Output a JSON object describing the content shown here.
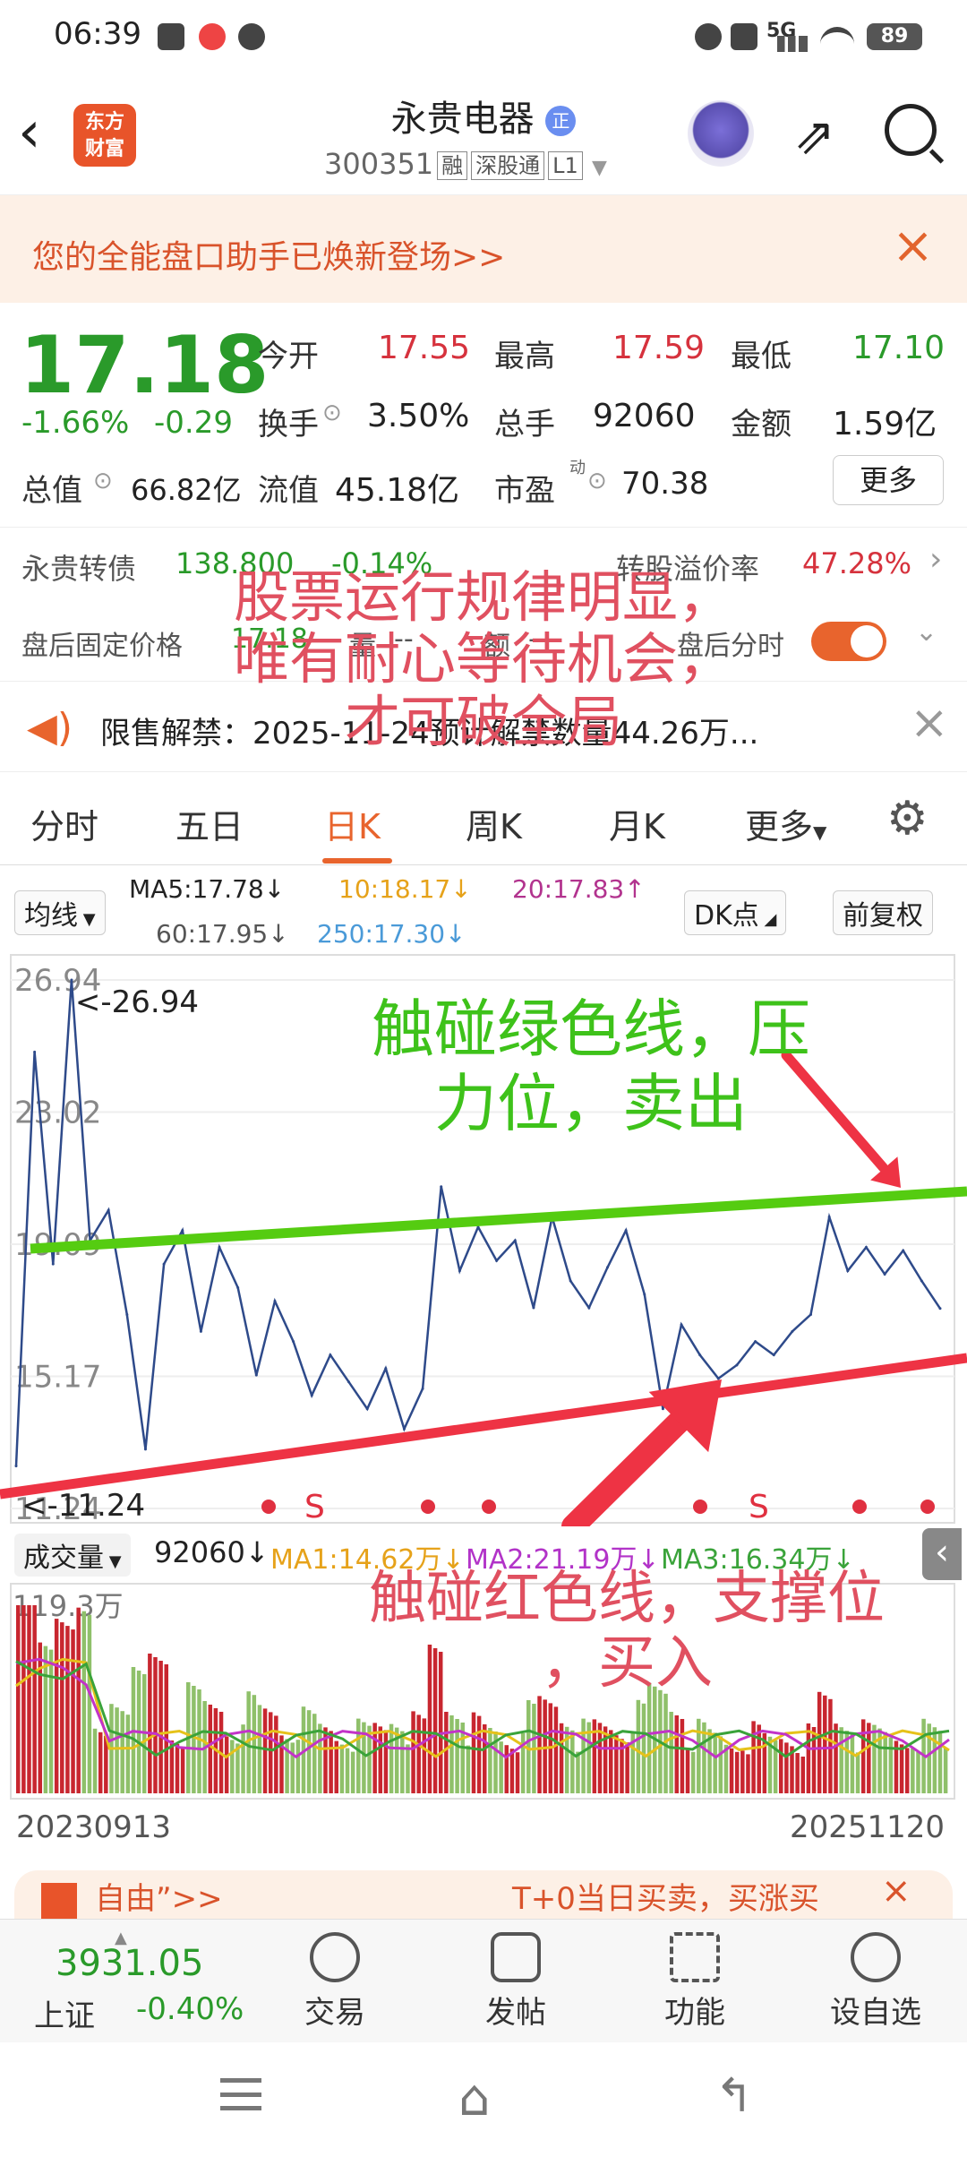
{
  "status_bar": {
    "time": "06:39",
    "battery": "89",
    "network": "5G"
  },
  "header": {
    "app_logo": "东方\n财富",
    "stock_name": "永贵电器",
    "badge": "正",
    "code": "300351",
    "tags": [
      "融",
      "深股通",
      "L1"
    ]
  },
  "banner": {
    "text": "您的全能盘口助手已焕新登场>>"
  },
  "quote": {
    "price": "17.18",
    "change_pct": "-1.66%",
    "change": "-0.29",
    "open_label": "今开",
    "open": "17.55",
    "high_label": "最高",
    "high": "17.59",
    "low_label": "最低",
    "low": "17.10",
    "turnover_label": "换手",
    "turnover": "3.50%",
    "volume_label": "总手",
    "volume": "92060",
    "amount_label": "金额",
    "amount": "1.59亿",
    "mcap_label": "总值",
    "mcap": "66.82亿",
    "float_label": "流值",
    "float": "45.18亿",
    "pe_label": "市盈",
    "pe_sup": "动",
    "pe": "70.38",
    "more": "更多"
  },
  "bond": {
    "name": "永贵转债",
    "price": "138.800",
    "change": "-0.14%",
    "premium_label": "转股溢价率",
    "premium": "47.28%"
  },
  "after_hours": {
    "fixed_price_label": "盘后固定价格",
    "fixed_price": "17.18",
    "volume_label": "量",
    "volume": "--",
    "amount_label": "额",
    "amount": "--",
    "timeshare_label": "盘后分时"
  },
  "notice": {
    "text": "限售解禁：2025-11-24预计解禁数量44.26万..."
  },
  "overlay": {
    "top_red": [
      "股票运行规律明显，",
      "唯有耐心等待机会，",
      "才可破全局"
    ],
    "green": [
      "触碰绿色线，压",
      "力位，卖出"
    ],
    "bottom_red": [
      "触碰红色线，支撑位",
      "，买入"
    ]
  },
  "tabs": [
    "分时",
    "五日",
    "日K",
    "周K",
    "月K",
    "更多",
    "settings"
  ],
  "active_tab": "日K",
  "ma_bar": {
    "selector": "均线",
    "ma5": "MA5:17.78↓",
    "ma10": "10:18.17↓",
    "ma20": "20:17.83↑",
    "ma60": "60:17.95↓",
    "ma250": "250:17.30↓",
    "dk": "DK点",
    "adjust": "前复权"
  },
  "price_chart": {
    "y_ticks": [
      "26.94",
      "23.02",
      "19.09",
      "15.17",
      "11.24"
    ],
    "max_label": "<-26.94",
    "min_label": "<-11.24",
    "s_marks": [
      "S",
      "S"
    ]
  },
  "volume_bar": {
    "selector": "成交量",
    "volume": "92060↓",
    "ma1": "MA1:14.62万↓",
    "ma2": "MA2:21.19万↓",
    "ma3": "MA3:16.34万↓",
    "y_max": "119.3万"
  },
  "date_range": {
    "start": "20230913",
    "end": "20251120"
  },
  "promo": {
    "left": "自由”>>",
    "right": "T+0当日买卖，买涨买"
  },
  "bottom_bar": {
    "index_value": "3931.05",
    "index_name": "上证",
    "index_change": "-0.40%",
    "items": [
      "交易",
      "发帖",
      "功能",
      "设自选"
    ]
  },
  "colors": {
    "accent": "#e8642d",
    "up": "#d6323d",
    "down": "#2a9a2a",
    "support_line": "#ee3344",
    "resistance_line": "#55cc11"
  },
  "chart_data": {
    "type": "line",
    "title": "",
    "xlabel": "",
    "ylabel": "",
    "x_range": [
      "20230913",
      "20251120"
    ],
    "ylim": [
      11.24,
      26.94
    ],
    "series": [
      {
        "values": [
          12.5,
          24.8,
          18.5,
          26.94,
          19.2,
          20.1,
          17.0,
          13.0,
          18.5,
          19.5,
          16.5,
          19.0,
          17.8,
          15.2,
          17.4,
          16.2,
          14.6,
          15.8,
          15.0,
          14.2,
          15.4,
          13.6,
          14.8,
          20.8,
          18.3,
          19.6,
          18.6,
          19.2,
          17.2,
          19.9,
          18.0,
          17.2,
          18.4,
          19.5,
          17.6,
          14.2,
          16.7,
          15.8,
          15.1,
          15.5,
          16.2,
          15.8,
          16.5,
          17.0,
          19.9,
          18.3,
          19.0,
          18.2,
          18.9,
          18.0,
          17.18
        ]
      }
    ],
    "ma_values": {
      "MA5": 17.78,
      "MA10": 18.17,
      "MA20": 17.83,
      "MA60": 17.95,
      "MA250": 17.3
    },
    "volume": {
      "latest": 92060,
      "y_max_label": "119.3万",
      "MA1": "14.62万",
      "MA2": "21.19万",
      "MA3": "16.34万"
    }
  }
}
